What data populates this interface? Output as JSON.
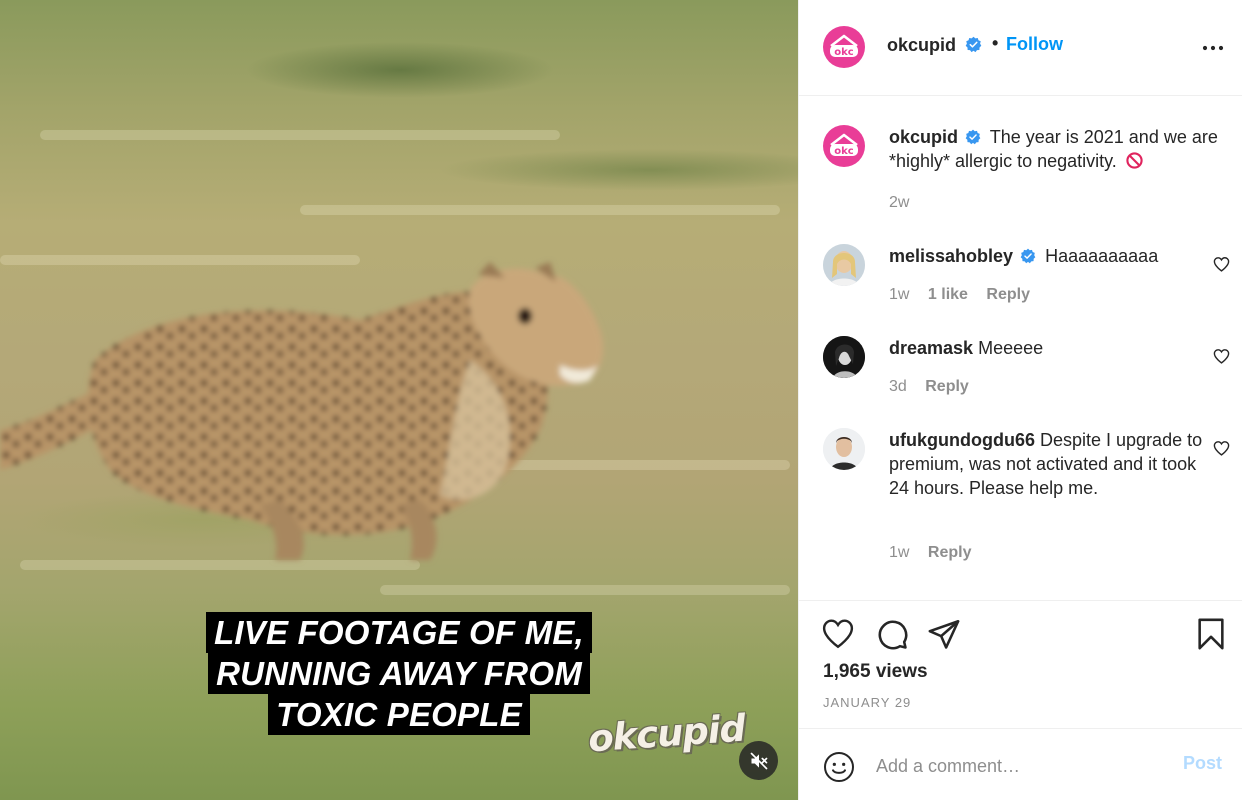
{
  "media": {
    "caption_lines": [
      "LIVE FOOTAGE OF ME,",
      "RUNNING AWAY FROM",
      "TOXIC PEOPLE"
    ],
    "watermark": "okcupid",
    "mute_icon": "speaker-muted-icon"
  },
  "header": {
    "avatar_text": "okc",
    "username": "okcupid",
    "separator": "•",
    "follow_label": "Follow",
    "more_icon": "more-horizontal-icon"
  },
  "post_caption": {
    "username": "okcupid",
    "text": "The year is 2021 and we are *highly* allergic to negativity.",
    "emoji": "no-entry-icon",
    "time": "2w"
  },
  "comments": [
    {
      "username": "melissahobley",
      "verified": true,
      "text": "Haaaaaaaaaa",
      "time": "1w",
      "likes": "1 like",
      "reply": "Reply"
    },
    {
      "username": "dreamask",
      "verified": false,
      "text": "Meeeee",
      "time": "3d",
      "reply": "Reply"
    },
    {
      "username": "ufukgundogdu66",
      "verified": false,
      "text": "Despite I upgrade to premium, was not activated and it took 24 hours. Please help me.",
      "time": "1w",
      "reply": "Reply"
    }
  ],
  "actions": {
    "views": "1,965 views",
    "date": "JANUARY 29"
  },
  "add_comment": {
    "placeholder": "Add a comment…",
    "post_label": "Post"
  },
  "colors": {
    "brand_pink": "#e93d97",
    "link_blue": "#0095f6",
    "post_disabled": "#b3dbff",
    "verified_blue": "#3897f0"
  }
}
